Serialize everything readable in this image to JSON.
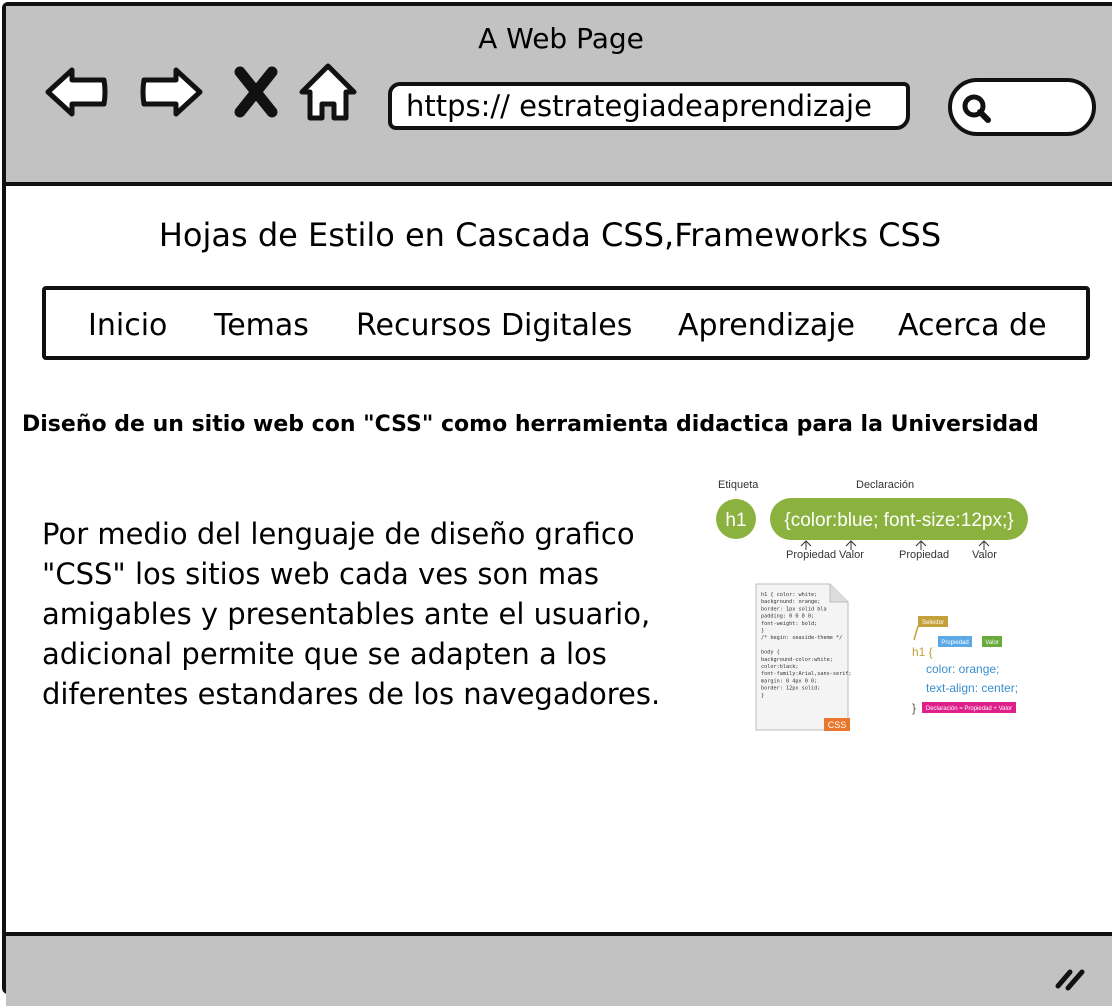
{
  "window": {
    "title": "A Web Page"
  },
  "toolbar": {
    "back_icon": "back-arrow-icon",
    "forward_icon": "forward-arrow-icon",
    "close_icon": "close-x-icon",
    "home_icon": "home-icon",
    "url": "https://  estrategiadeaprendizaje",
    "search_icon": "search-icon"
  },
  "page": {
    "title": "Hojas de Estilo en Cascada CSS,Frameworks CSS",
    "nav": [
      "Inicio",
      "Temas",
      "Recursos Digitales",
      "Aprendizaje",
      "Acerca de"
    ],
    "headline": "Diseño de un sitio web con \"CSS\" como herramienta didactica para la Universidad",
    "body": "Por medio del lenguaje de diseño grafico \"CSS\" los sitios web cada ves son mas amigables y presentables ante el usuario, adicional permite que se adapten a los diferentes estandares de los navegadores."
  },
  "figure": {
    "label_etiqueta": "Etiqueta",
    "label_declaracion": "Declaración",
    "selector": "h1",
    "declaration": "{color:blue; font-size:12px;}",
    "label_propiedad_1": "Propiedad",
    "label_valor_1": "Valor",
    "label_propiedad_2": "Propiedad",
    "label_valor_2": "Valor",
    "code_lines": [
      "h1 { color: white;",
      "  background: orange;",
      "  border: 1px solid bla",
      "  padding: 0 0 0 0;",
      "  font-weight: bold;",
      "}",
      "/* begin: seaside-theme */",
      "",
      "body {",
      "  background-color:white;",
      "  color:black;",
      "  font-family:Arial,sans-serif;",
      "  margin: 0 4px 0 0;",
      "  border: 12px solid;",
      "}"
    ],
    "css_badge": "CSS",
    "tag_selector": "Selector",
    "tag_propiedad": "Propiedad",
    "tag_valor": "Valor",
    "rule_open": "h1 {",
    "rule_line_1": "color: orange;",
    "rule_line_2": "text-align: center;",
    "rule_close": "}",
    "rule_note": "Declaración = Propiedad + Valor"
  }
}
